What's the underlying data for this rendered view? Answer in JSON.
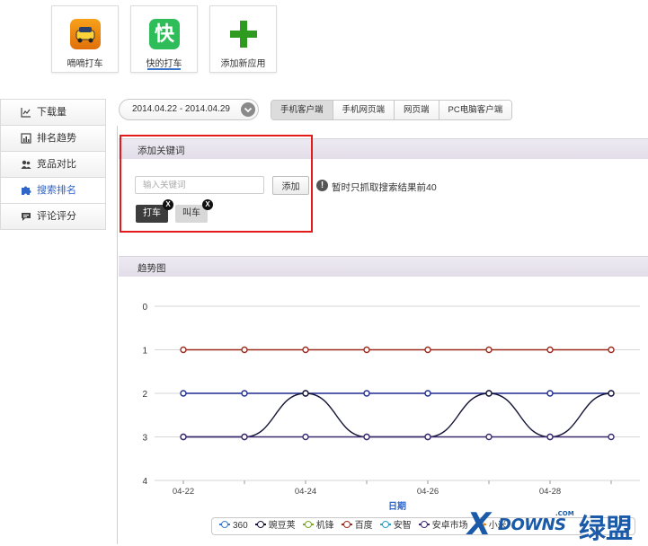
{
  "apps": [
    {
      "name": "嘀嘀打车",
      "icon": "taxi-app-icon",
      "active": false
    },
    {
      "name": "快的打车",
      "icon": "kuaidi-app-icon",
      "icon_char": "快",
      "active": true
    },
    {
      "name": "添加新应用",
      "icon": "plus-icon",
      "active": false
    }
  ],
  "sidebar": {
    "items": [
      {
        "label": "下载量",
        "icon": "line-chart-icon",
        "active": false
      },
      {
        "label": "排名趋势",
        "icon": "bar-chart-icon",
        "active": false
      },
      {
        "label": "竞品对比",
        "icon": "users-icon",
        "active": false
      },
      {
        "label": "搜索排名",
        "icon": "puzzle-icon",
        "active": true
      },
      {
        "label": "评论评分",
        "icon": "comment-icon",
        "active": false
      }
    ]
  },
  "date_range": "2014.04.22 - 2014.04.29",
  "platform_tabs": [
    "手机客户端",
    "手机网页端",
    "网页端",
    "PC电脑客户端"
  ],
  "platform_tab_active": 0,
  "keyword_panel": {
    "title": "添加关键词",
    "input_placeholder": "输入关键词",
    "add_button": "添加",
    "note": "暂时只抓取搜索结果前40",
    "tags": [
      "打车",
      "叫车"
    ],
    "tag_remove": "X"
  },
  "trend_panel": {
    "title": "趋势图"
  },
  "chart_data": {
    "type": "line",
    "xlabel": "日期",
    "x": [
      "04-22",
      "04-23",
      "04-24",
      "04-25",
      "04-26",
      "04-27",
      "04-28",
      "04-29"
    ],
    "x_tick_labels": [
      "04-22",
      "04-24",
      "04-26",
      "04-28"
    ],
    "ylim": [
      0,
      4
    ],
    "y_ticks": [
      0,
      1,
      2,
      3,
      4
    ],
    "y_reversed": true,
    "grid": true,
    "series": [
      {
        "name": "百度",
        "color": "#9c2a1e",
        "values": [
          1,
          1,
          1,
          1,
          1,
          1,
          1,
          1
        ]
      },
      {
        "name": "360",
        "color": "#1f2c8f",
        "values": [
          2,
          2,
          2,
          2,
          2,
          2,
          2,
          2
        ]
      },
      {
        "name": "豌豆荚",
        "color": "#151538",
        "values": [
          3,
          3,
          2,
          3,
          3,
          2,
          3,
          2
        ]
      },
      {
        "name": "安卓市场",
        "color": "#3b2a6e",
        "values": [
          3,
          3,
          3,
          3,
          3,
          3,
          3,
          3
        ]
      }
    ],
    "legend": [
      {
        "name": "360",
        "color": "#3c78c8"
      },
      {
        "name": "豌豆荚",
        "color": "#151538"
      },
      {
        "name": "机锋",
        "color": "#7fa628"
      },
      {
        "name": "百度",
        "color": "#9c2a1e"
      },
      {
        "name": "安智",
        "color": "#2aa0c8"
      },
      {
        "name": "安卓市场",
        "color": "#3b2a6e"
      },
      {
        "name": "小米",
        "color": "#e08a2a"
      }
    ],
    "legend_placement": "bottom"
  },
  "watermark": {
    "main": "DOWNS",
    "sub": ".COM",
    "cn": "绿盟"
  },
  "colors": {
    "accent": "#3b73c9",
    "highlight": "#e21b1b",
    "grid": "#d6d6d6"
  }
}
